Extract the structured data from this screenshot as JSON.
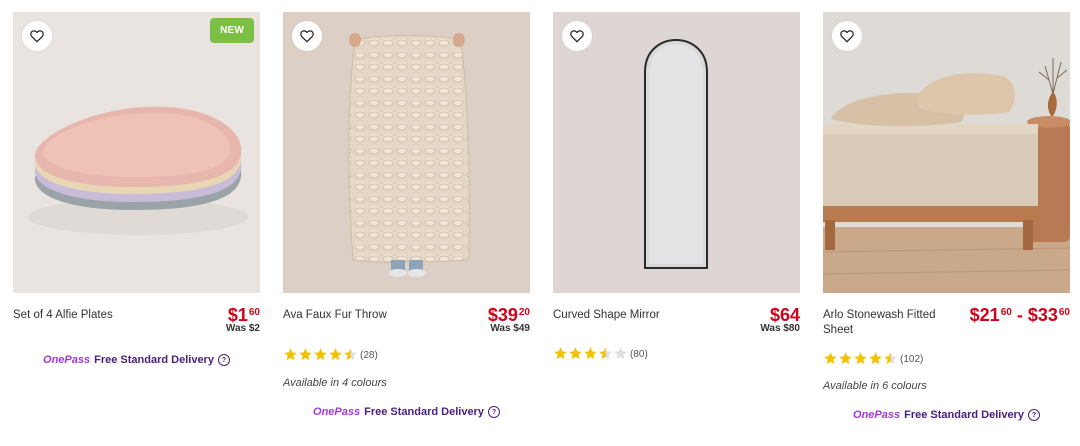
{
  "colors": {
    "price": "#d0021b",
    "onepass": "#a437d9",
    "badge": "#7bc043",
    "star": "#f2c200"
  },
  "products": [
    {
      "name": "Set of 4 Alfie Plates",
      "badge": "NEW",
      "price_dollars": "$1",
      "price_cents": "60",
      "was": "Was $2",
      "delivery": {
        "brand": "OnePass",
        "text": "Free Standard Delivery"
      }
    },
    {
      "name": "Ava Faux Fur Throw",
      "price_dollars": "$39",
      "price_cents": "20",
      "was": "Was $49",
      "rating": 4.5,
      "rating_count": "(28)",
      "colours": "Available in 4 colours",
      "delivery": {
        "brand": "OnePass",
        "text": "Free Standard Delivery"
      }
    },
    {
      "name": "Curved Shape Mirror",
      "price_dollars": "$64",
      "was": "Was $80",
      "rating": 3.5,
      "rating_count": "(80)"
    },
    {
      "name": "Arlo Stonewash Fitted Sheet",
      "price_from_dollars": "$21",
      "price_from_cents": "60",
      "price_sep": " - ",
      "price_to_dollars": "$33",
      "price_to_cents": "60",
      "rating": 4.5,
      "rating_count": "(102)",
      "colours": "Available in 6 colours",
      "delivery": {
        "brand": "OnePass",
        "text": "Free Standard Delivery"
      }
    }
  ]
}
